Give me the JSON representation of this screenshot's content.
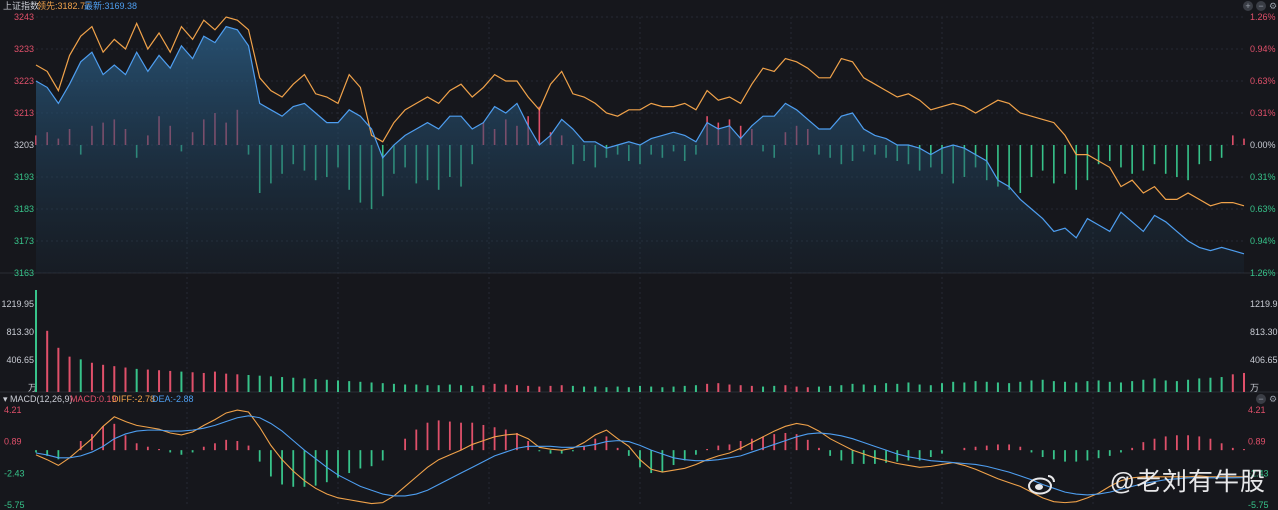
{
  "header": {
    "index_name": "上证指数",
    "lead_label": "领先:3182.77",
    "latest_label": "最新:3169.38"
  },
  "macd_header": {
    "name": "MACD(12,26,9)",
    "macd": "MACD:0.19",
    "diff": "DIFF:-2.78",
    "dea": "DEA:-2.88"
  },
  "controls": [
    {
      "name": "zoom-in-icon",
      "glyph": "+"
    },
    {
      "name": "zoom-out-icon",
      "glyph": "−"
    },
    {
      "name": "settings-icon",
      "glyph": "⚙"
    }
  ],
  "watermark": "@老刘有牛股",
  "colors": {
    "background": "#16171c",
    "up": "#e0506a",
    "down": "#37c38a",
    "lead_line": "#f0a24a",
    "latest_line": "#4e9ef0",
    "area_fill": "#1d3a52",
    "grid": "#262a33",
    "text": "#c9ccd4"
  },
  "chart_data": [
    {
      "type": "line",
      "panel": "price",
      "y_left_ticks": [
        "3243",
        "3233",
        "3223",
        "3213",
        "3203",
        "3193",
        "3183",
        "3173",
        "3163"
      ],
      "y_right_ticks": [
        "1.26%",
        "0.94%",
        "0.63%",
        "0.31%",
        "0.00%",
        "0.31%",
        "0.63%",
        "0.94%",
        "1.26%"
      ],
      "ylim": [
        3163,
        3243
      ],
      "baseline": 3203,
      "series": [
        {
          "name": "领先",
          "color": "#f0a24a",
          "points": [
            3228,
            3226,
            3220,
            3231,
            3237,
            3240,
            3232,
            3236,
            3233,
            3241,
            3233,
            3238,
            3232,
            3240,
            3236,
            3242,
            3239,
            3243,
            3242,
            3239,
            3224,
            3220,
            3218,
            3222,
            3225,
            3219,
            3218,
            3216,
            3225,
            3221,
            3206,
            3204,
            3210,
            3214,
            3216,
            3218,
            3216,
            3220,
            3222,
            3218,
            3221,
            3225,
            3223,
            3223,
            3218,
            3214,
            3222,
            3226,
            3219,
            3218,
            3216,
            3213,
            3212,
            3214,
            3214,
            3216,
            3215,
            3215,
            3216,
            3214,
            3220,
            3217,
            3218,
            3216,
            3222,
            3227,
            3226,
            3230,
            3229,
            3227,
            3224,
            3224,
            3230,
            3229,
            3224,
            3222,
            3220,
            3218,
            3219,
            3217,
            3214,
            3215,
            3216,
            3215,
            3213,
            3215,
            3217,
            3216,
            3213,
            3212,
            3211,
            3210,
            3206,
            3200,
            3200,
            3198,
            3196,
            3190,
            3192,
            3188,
            3190,
            3186,
            3186,
            3188,
            3186,
            3184,
            3185,
            3185,
            3184
          ]
        },
        {
          "name": "最新",
          "color": "#4e9ef0",
          "points": [
            3223,
            3221,
            3216,
            3222,
            3229,
            3232,
            3225,
            3228,
            3225,
            3232,
            3226,
            3231,
            3227,
            3234,
            3230,
            3237,
            3235,
            3240,
            3239,
            3234,
            3216,
            3214,
            3212,
            3215,
            3216,
            3213,
            3210,
            3210,
            3214,
            3212,
            3208,
            3199,
            3203,
            3206,
            3208,
            3210,
            3208,
            3212,
            3212,
            3208,
            3210,
            3215,
            3213,
            3216,
            3209,
            3203,
            3206,
            3211,
            3208,
            3204,
            3204,
            3202,
            3203,
            3204,
            3203,
            3205,
            3206,
            3207,
            3206,
            3204,
            3210,
            3208,
            3209,
            3205,
            3209,
            3212,
            3212,
            3216,
            3214,
            3211,
            3208,
            3208,
            3212,
            3213,
            3208,
            3206,
            3205,
            3203,
            3203,
            3202,
            3200,
            3202,
            3203,
            3202,
            3200,
            3198,
            3192,
            3190,
            3186,
            3183,
            3180,
            3176,
            3177,
            3174,
            3180,
            3178,
            3176,
            3182,
            3179,
            3176,
            3181,
            3179,
            3176,
            3173,
            3171,
            3170,
            3171,
            3170,
            3169
          ]
        }
      ],
      "bars": [
        3,
        4,
        2,
        5,
        -3,
        6,
        7,
        8,
        5,
        -4,
        3,
        9,
        6,
        -2,
        4,
        8,
        10,
        7,
        11,
        -3,
        -15,
        -12,
        -9,
        -6,
        -8,
        -11,
        -10,
        -7,
        -14,
        -18,
        -20,
        -16,
        -9,
        -7,
        -12,
        -11,
        -14,
        -10,
        -13,
        -6,
        7,
        5,
        8,
        6,
        9,
        12,
        4,
        3,
        -6,
        -5,
        -7,
        -4,
        -3,
        -5,
        -6,
        -3,
        -4,
        -2,
        -5,
        -3,
        9,
        7,
        8,
        6,
        5,
        -2,
        -4,
        4,
        6,
        5,
        -3,
        -4,
        -6,
        -5,
        -2,
        -3,
        -4,
        -5,
        -6,
        -8,
        -7,
        -9,
        -12,
        -10,
        -7,
        -11,
        -13,
        -14,
        -15,
        -10,
        -8,
        -12,
        -9,
        -14,
        -11,
        -6,
        -5,
        -7,
        -9,
        -8,
        -6,
        -9,
        -10,
        -11,
        -6,
        -5,
        -4,
        3,
        2
      ]
    },
    {
      "type": "bar",
      "panel": "volume",
      "y_ticks": [
        "1219.95",
        "813.30",
        "406.65"
      ],
      "unit": "万",
      "ylim": [
        0,
        1500
      ],
      "values": [
        1500,
        900,
        650,
        520,
        480,
        430,
        400,
        380,
        360,
        340,
        330,
        320,
        310,
        300,
        290,
        280,
        300,
        270,
        260,
        250,
        240,
        230,
        220,
        210,
        200,
        190,
        180,
        170,
        160,
        150,
        140,
        130,
        120,
        110,
        110,
        100,
        100,
        110,
        100,
        90,
        100,
        120,
        110,
        100,
        90,
        80,
        90,
        100,
        90,
        80,
        80,
        70,
        80,
        70,
        90,
        80,
        70,
        80,
        90,
        100,
        120,
        130,
        110,
        100,
        90,
        80,
        90,
        100,
        80,
        70,
        80,
        90,
        100,
        120,
        110,
        100,
        130,
        120,
        140,
        110,
        100,
        130,
        150,
        140,
        160,
        150,
        140,
        130,
        150,
        170,
        180,
        160,
        150,
        140,
        160,
        170,
        150,
        140,
        160,
        180,
        200,
        170,
        160,
        180,
        200,
        210,
        220,
        260,
        280
      ]
    },
    {
      "type": "line",
      "panel": "macd",
      "y_ticks": [
        "4.21",
        "0.89",
        "-2.43",
        "-5.75"
      ],
      "ylim": [
        -5.75,
        4.21
      ],
      "series": [
        {
          "name": "DIFF",
          "color": "#f0a24a",
          "points": [
            -0.5,
            -1.0,
            -1.6,
            -0.8,
            0.2,
            1.2,
            2.5,
            3.5,
            3.0,
            2.6,
            2.4,
            2.2,
            1.8,
            1.6,
            1.9,
            2.6,
            3.2,
            3.9,
            4.2,
            4.0,
            2.4,
            0.5,
            -1.0,
            -2.2,
            -3.2,
            -4.0,
            -4.6,
            -5.0,
            -5.2,
            -5.4,
            -5.6,
            -5.5,
            -4.8,
            -3.8,
            -2.8,
            -1.8,
            -1.0,
            -0.5,
            0.0,
            0.6,
            1.0,
            1.4,
            1.6,
            1.7,
            1.2,
            0.3,
            0.1,
            0.0,
            0.2,
            0.8,
            1.6,
            2.1,
            1.2,
            0.4,
            -1.0,
            -2.0,
            -2.3,
            -2.1,
            -1.9,
            -1.5,
            -1.0,
            -0.6,
            -0.3,
            0.2,
            0.8,
            1.4,
            2.0,
            2.5,
            2.8,
            2.6,
            2.0,
            1.2,
            0.6,
            0.0,
            -0.4,
            -0.8,
            -1.1,
            -1.4,
            -1.6,
            -1.8,
            -1.7,
            -1.5,
            -1.3,
            -1.6,
            -2.0,
            -2.5,
            -3.0,
            -3.4,
            -3.8,
            -4.4,
            -5.0,
            -5.4,
            -5.5,
            -5.4,
            -5.0,
            -4.5,
            -3.8,
            -3.2,
            -2.9,
            -2.8,
            -2.8,
            -2.8,
            -2.8,
            -2.8,
            -2.7,
            -2.8,
            -2.8,
            -2.8,
            -2.8
          ]
        },
        {
          "name": "DEA",
          "color": "#4e9ef0",
          "points": [
            -0.3,
            -0.5,
            -0.8,
            -0.8,
            -0.6,
            -0.2,
            0.4,
            1.2,
            1.7,
            2.0,
            2.1,
            2.1,
            2.0,
            2.0,
            2.1,
            2.3,
            2.6,
            3.0,
            3.4,
            3.6,
            3.4,
            2.8,
            2.0,
            1.0,
            0.0,
            -0.9,
            -1.8,
            -2.6,
            -3.2,
            -3.8,
            -4.2,
            -4.6,
            -4.8,
            -4.8,
            -4.6,
            -4.2,
            -3.6,
            -3.0,
            -2.4,
            -1.8,
            -1.2,
            -0.6,
            -0.2,
            0.2,
            0.4,
            0.4,
            0.4,
            0.3,
            0.3,
            0.4,
            0.6,
            0.9,
            1.0,
            0.9,
            0.5,
            0.0,
            -0.4,
            -0.8,
            -1.0,
            -1.1,
            -1.1,
            -1.0,
            -0.8,
            -0.6,
            -0.2,
            0.2,
            0.6,
            1.0,
            1.4,
            1.7,
            1.8,
            1.7,
            1.5,
            1.2,
            0.8,
            0.4,
            0.0,
            -0.4,
            -0.7,
            -0.9,
            -1.1,
            -1.2,
            -1.3,
            -1.4,
            -1.5,
            -1.7,
            -2.0,
            -2.3,
            -2.7,
            -3.1,
            -3.6,
            -4.0,
            -4.4,
            -4.6,
            -4.7,
            -4.6,
            -4.4,
            -4.1,
            -3.8,
            -3.5,
            -3.3,
            -3.1,
            -3.0,
            -2.9,
            -2.9,
            -2.9,
            -2.9,
            -2.9,
            -2.88
          ]
        }
      ],
      "histogram": [
        -0.4,
        -1.0,
        -1.6,
        0,
        1.6,
        2.8,
        4.2,
        4.6,
        2.6,
        1.2,
        0.6,
        0.2,
        -0.4,
        -0.8,
        -0.4,
        0.6,
        1.2,
        1.8,
        1.6,
        0.8,
        -2.0,
        -4.6,
        -6.0,
        -6.4,
        -6.4,
        -6.2,
        -5.6,
        -4.8,
        -4.0,
        -3.2,
        -2.8,
        -1.8,
        0,
        2.0,
        3.6,
        4.8,
        5.2,
        5.0,
        4.8,
        4.8,
        4.4,
        4.0,
        3.6,
        3.0,
        1.6,
        -0.2,
        -0.6,
        -0.6,
        -0.2,
        0.8,
        2.0,
        2.4,
        0.4,
        -1.0,
        -3.0,
        -4.0,
        -3.8,
        -2.6,
        -1.8,
        -0.8,
        0.2,
        0.8,
        1.0,
        1.6,
        2.0,
        2.4,
        2.8,
        3.0,
        2.8,
        1.8,
        0.4,
        -1.0,
        -1.8,
        -2.4,
        -2.4,
        -2.4,
        -2.2,
        -2.0,
        -1.8,
        -1.8,
        -1.2,
        -0.6,
        0,
        0.4,
        0.6,
        0.8,
        1.0,
        1.0,
        0.6,
        -0.4,
        -1.2,
        -1.6,
        -2.0,
        -2.0,
        -1.8,
        -1.4,
        -1.0,
        -0.4,
        0.4,
        1.4,
        2.0,
        2.4,
        2.6,
        2.6,
        2.4,
        2.0,
        1.2,
        0.4,
        0.2
      ]
    }
  ]
}
